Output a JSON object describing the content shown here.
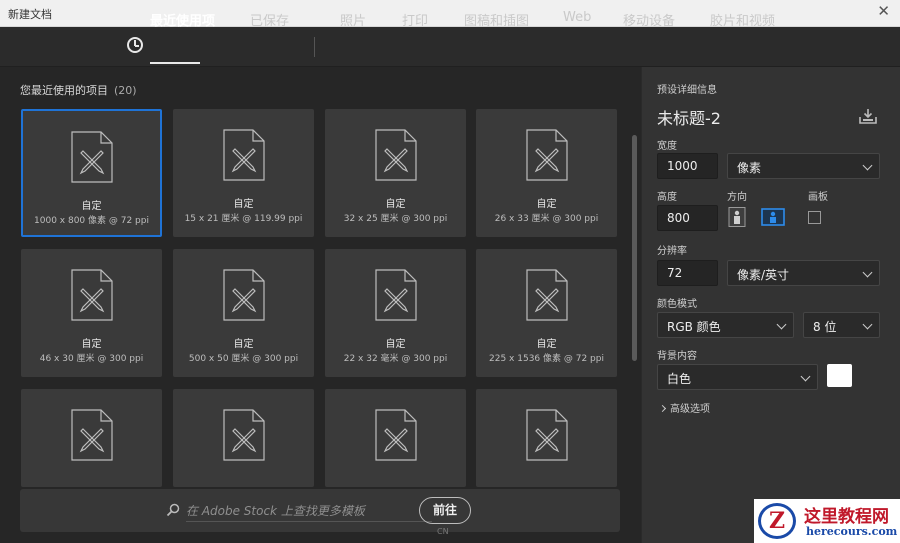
{
  "window": {
    "title": "新建文档",
    "close_glyph": "✕"
  },
  "tabs": [
    {
      "label": "最近使用项",
      "active": true
    },
    {
      "label": "已保存"
    },
    {
      "label": "照片"
    },
    {
      "label": "打印"
    },
    {
      "label": "图稿和插图"
    },
    {
      "label": "Web"
    },
    {
      "label": "移动设备"
    },
    {
      "label": "胶片和视频"
    }
  ],
  "recent": {
    "title": "您最近使用的项目",
    "count": "(20)",
    "items": [
      {
        "name": "自定",
        "size": "1000 x 800 像素 @ 72 ppi",
        "selected": true
      },
      {
        "name": "自定",
        "size": "15 x 21 厘米 @ 119.99 ppi"
      },
      {
        "name": "自定",
        "size": "32 x 25 厘米 @ 300 ppi"
      },
      {
        "name": "自定",
        "size": "26 x 33 厘米 @ 300 ppi"
      },
      {
        "name": "自定",
        "size": "46 x 30 厘米 @ 300 ppi"
      },
      {
        "name": "自定",
        "size": "500 x 50 厘米 @ 300 ppi"
      },
      {
        "name": "自定",
        "size": "22 x 32 毫米 @ 300 ppi"
      },
      {
        "name": "自定",
        "size": "225 x 1536 像素 @ 72 ppi"
      },
      {
        "name": "",
        "size": ""
      },
      {
        "name": "",
        "size": ""
      },
      {
        "name": "",
        "size": ""
      },
      {
        "name": "",
        "size": ""
      }
    ]
  },
  "search": {
    "placeholder": "在 Adobe Stock 上查找更多模板",
    "go_label": "前往"
  },
  "watermark_small": "CN",
  "preset": {
    "header": "预设详细信息",
    "doc_name": "未标题-2",
    "width_label": "宽度",
    "width_value": "1000",
    "width_unit": "像素",
    "height_label": "高度",
    "height_value": "800",
    "orientation_label": "方向",
    "artboard_label": "画板",
    "resolution_label": "分辨率",
    "resolution_value": "72",
    "resolution_unit": "像素/英寸",
    "color_mode_label": "颜色模式",
    "color_mode": "RGB 颜色",
    "bit_depth": "8 位",
    "background_label": "背景内容",
    "background": "白色",
    "advanced_label": "高级选项"
  },
  "logo": {
    "cn": "这里教程网",
    "en": "herecours.com",
    "mark": "Z"
  },
  "colors": {
    "accent": "#1f73d6",
    "background": "#2a2a2a",
    "card": "#3a3a3a",
    "panel": "#333333"
  }
}
